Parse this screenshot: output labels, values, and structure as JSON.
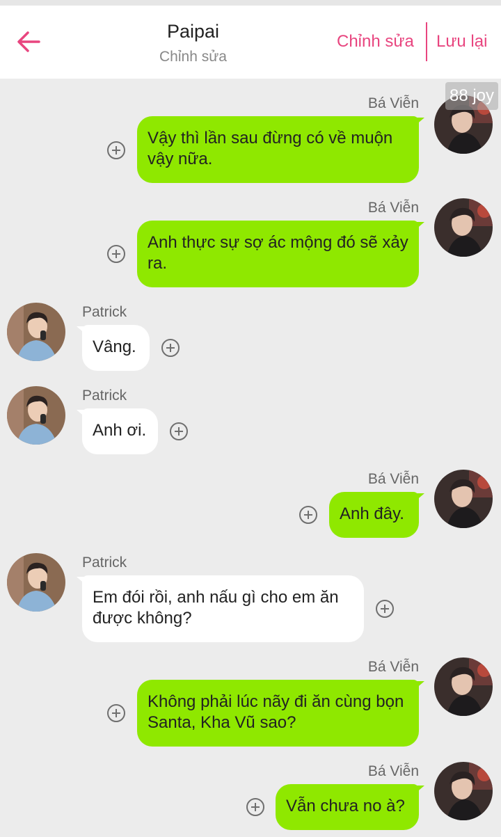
{
  "header": {
    "title": "Paipai",
    "subtitle": "Chỉnh sửa",
    "edit_label": "Chỉnh sửa",
    "save_label": "Lưu lại",
    "accent_color": "#e8457f"
  },
  "watermark": "88 joy",
  "messages": [
    {
      "sender": "Bá Viễn",
      "side": "right",
      "text": "Vậy thì lần sau đừng có về muộn vậy nữa."
    },
    {
      "sender": "Bá Viễn",
      "side": "right",
      "text": "Anh thực sự sợ ác mộng đó sẽ xảy ra."
    },
    {
      "sender": "Patrick",
      "side": "left",
      "text": "Vâng."
    },
    {
      "sender": "Patrick",
      "side": "left",
      "text": "Anh ơi."
    },
    {
      "sender": "Bá Viễn",
      "side": "right",
      "text": "Anh đây."
    },
    {
      "sender": "Patrick",
      "side": "left",
      "text": "Em đói rồi, anh nấu gì cho em ăn được không?"
    },
    {
      "sender": "Bá Viễn",
      "side": "right",
      "text": "Không phải lúc nãy đi ăn cùng bọn Santa, Kha Vũ sao?"
    },
    {
      "sender": "Bá Viễn",
      "side": "right",
      "text": "Vẫn chưa no à?"
    }
  ],
  "icons": {
    "back": "arrow-left-icon",
    "add": "plus-circle-icon"
  },
  "colors": {
    "sent_bubble": "#8fe800",
    "received_bubble": "#ffffff",
    "background": "#ececec"
  }
}
